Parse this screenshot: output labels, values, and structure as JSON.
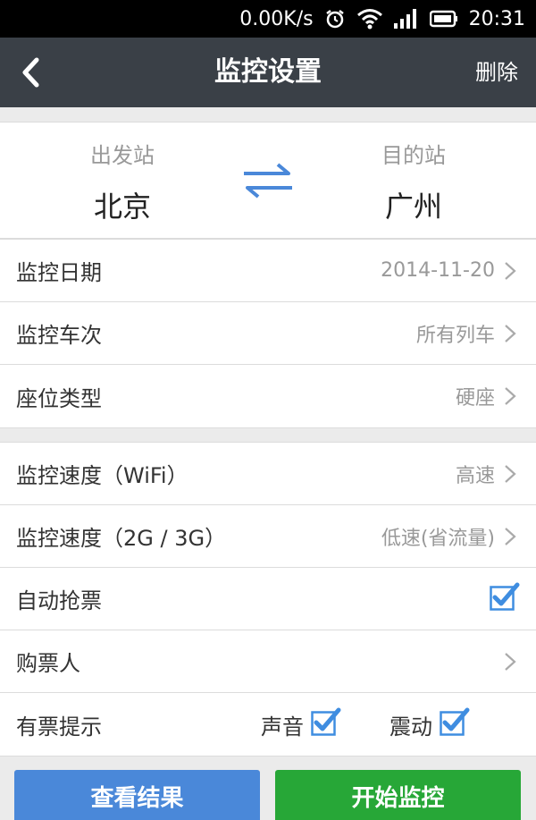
{
  "status_bar": {
    "speed": "0.00K/s",
    "time": "20:31"
  },
  "titlebar": {
    "title": "监控设置",
    "delete_label": "删除"
  },
  "stations": {
    "from_label": "出发站",
    "from_city": "北京",
    "to_label": "目的站",
    "to_city": "广州"
  },
  "settings": {
    "date": {
      "label": "监控日期",
      "value": "2014-11-20"
    },
    "train": {
      "label": "监控车次",
      "value": "所有列车"
    },
    "seat": {
      "label": "座位类型",
      "value": "硬座"
    }
  },
  "options": {
    "wifi_speed": {
      "label": "监控速度（WiFi）",
      "value": "高速"
    },
    "mobile_speed": {
      "label": "监控速度（2G / 3G）",
      "value": "低速(省流量)"
    },
    "auto_grab": {
      "label": "自动抢票",
      "checked": true
    },
    "passenger": {
      "label": "购票人"
    },
    "notify": {
      "label": "有票提示",
      "sound_label": "声音",
      "sound_checked": true,
      "vibrate_label": "震动",
      "vibrate_checked": true
    }
  },
  "buttons": {
    "view_results": "查看结果",
    "start_monitor": "开始监控"
  },
  "colors": {
    "titlebar": "#3a4047",
    "accent_blue": "#4a88d9",
    "accent_green": "#27a737",
    "check_blue": "#3f8de0"
  }
}
